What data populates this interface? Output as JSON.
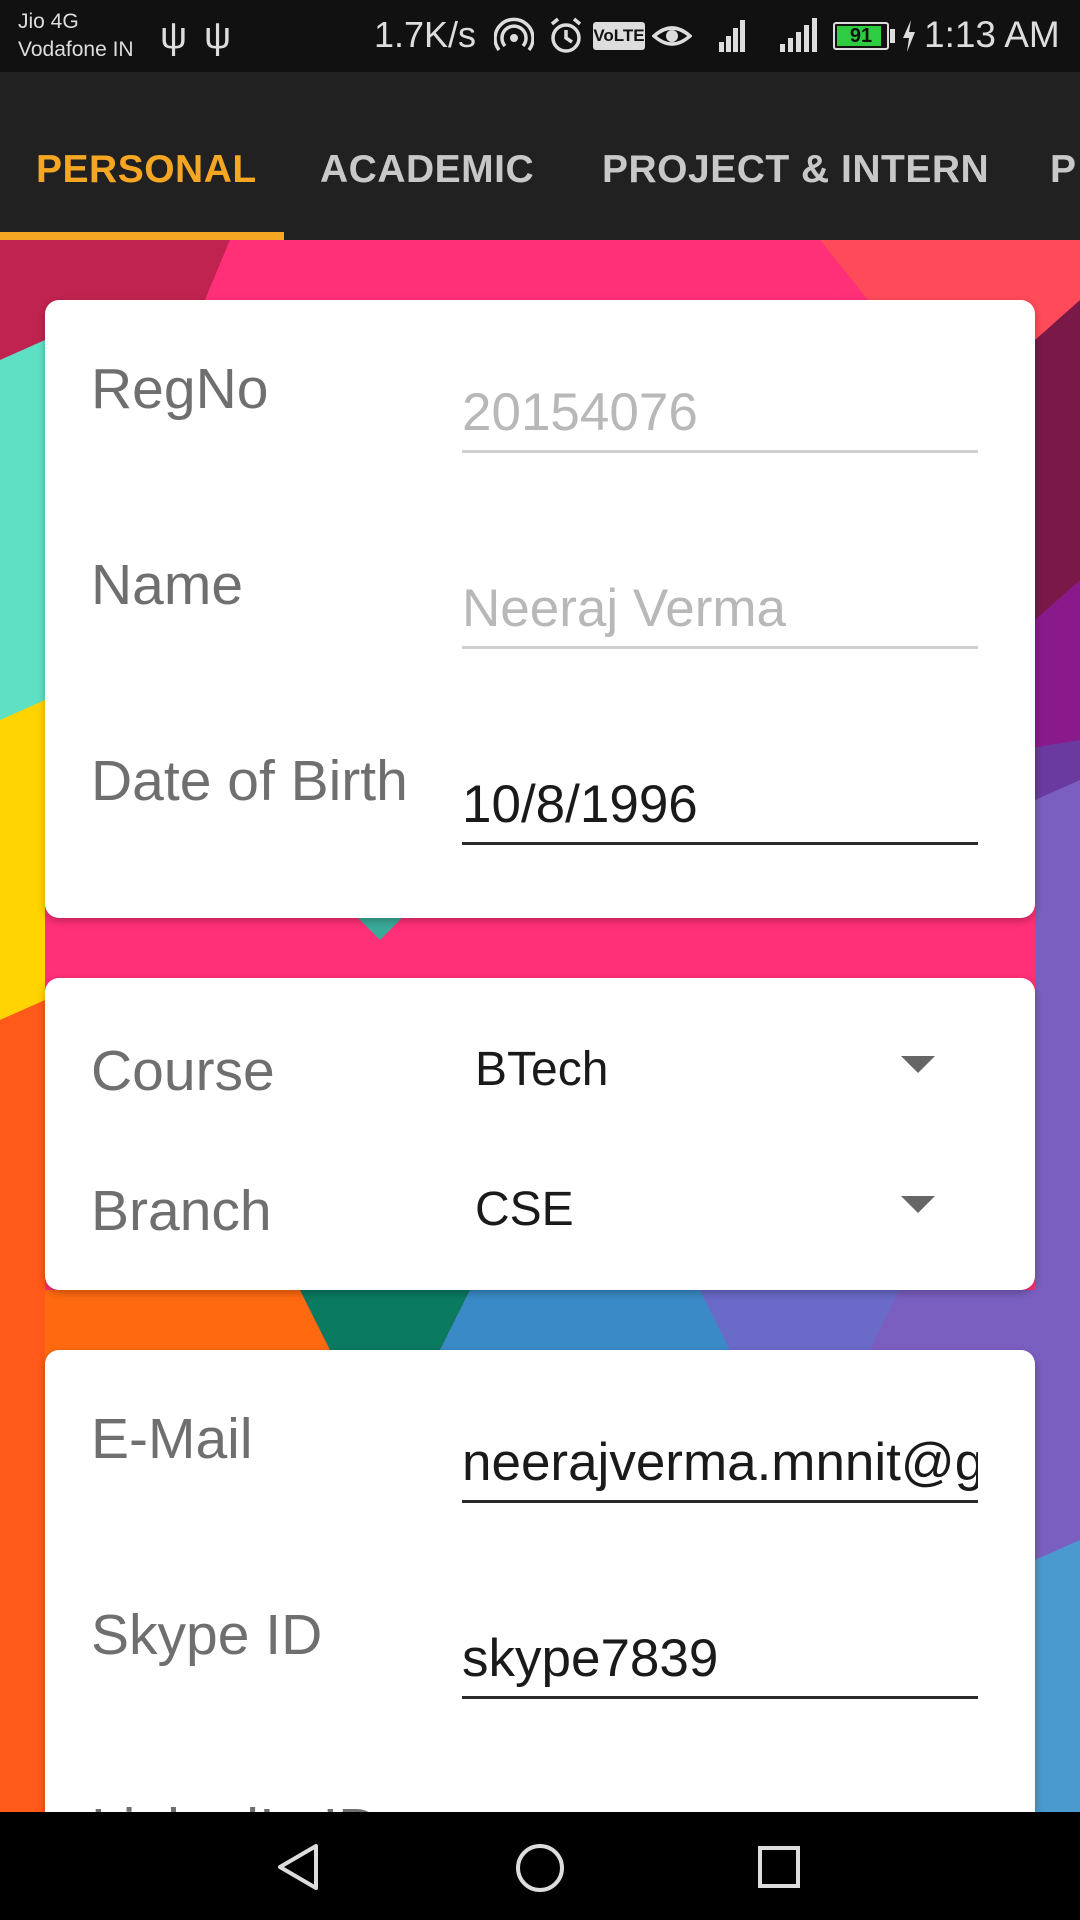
{
  "status_bar": {
    "carrier_1": "Jio 4G",
    "carrier_2": "Vodafone IN",
    "net_speed": "1.7K/s",
    "volte": "VoLTE",
    "battery": "91",
    "battery_level": 0.91,
    "time": "1:13 AM",
    "icons": [
      "usb-icon",
      "usb-icon",
      "hotspot-icon",
      "alarm-icon",
      "volte-icon",
      "eye-icon",
      "signal-4g-icon",
      "signal-icon",
      "battery-icon",
      "charging-icon"
    ]
  },
  "tabs": [
    {
      "label": "PERSONAL",
      "active": true
    },
    {
      "label": "ACADEMIC",
      "active": false
    },
    {
      "label": "PROJECT & INTERN",
      "active": false
    },
    {
      "label": "P",
      "active": false
    }
  ],
  "card1": {
    "regno_label": "RegNo",
    "regno_value": "20154076",
    "name_label": "Name",
    "name_value": "Neeraj Verma",
    "dob_label": "Date of Birth",
    "dob_value": "10/8/1996"
  },
  "card2": {
    "course_label": "Course",
    "course_value": "BTech",
    "branch_label": "Branch",
    "branch_value": "CSE"
  },
  "card3": {
    "email_label": "E-Mail",
    "email_value": "neerajverma.mnnit@g",
    "skype_label": "Skype ID",
    "skype_value": "skype7839",
    "linkedin_label": "LinkedIn ID"
  },
  "colors": {
    "accent": "#f5a623",
    "tab_bar": "#212121",
    "card_bg": "#ffffff",
    "label_text": "#6f6f6f"
  }
}
